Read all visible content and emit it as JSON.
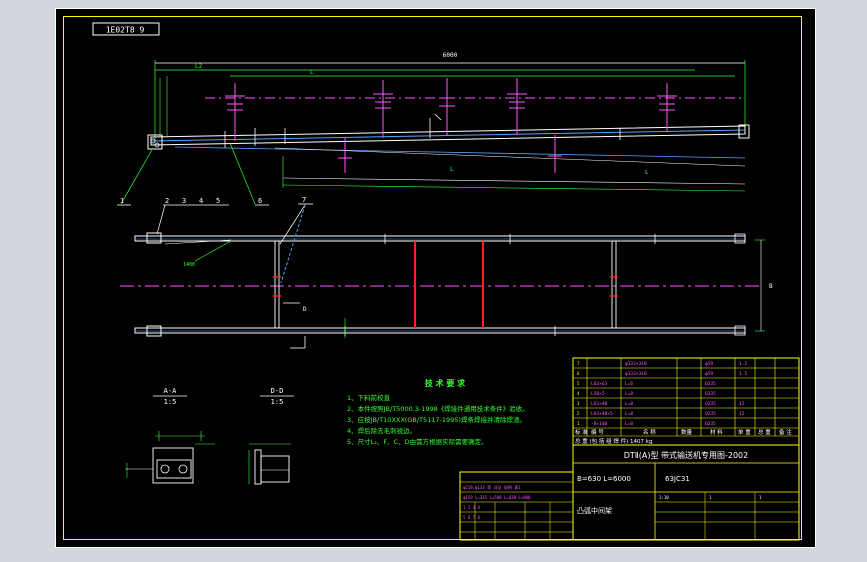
{
  "drawing": {
    "code_box": "1E02T8 9",
    "overall_dim": "6000",
    "dim_l2": "L2",
    "dim_top_mid": "L",
    "dim_bottom_mid": "L",
    "dim_bottom_right": "L",
    "dim_right": "B",
    "dim_small_left": "1400",
    "section_mark": "D",
    "part_labels": [
      "1",
      "2",
      "3",
      "4",
      "5",
      "6",
      "7"
    ],
    "section_a_title": "A-A",
    "section_a_scale": "1:5",
    "section_b_title": "D-D",
    "section_b_scale": "1:5"
  },
  "tech": {
    "title": "技 术 要 求",
    "lines": [
      "1、下料前校直",
      "2、本件按照JB/T5000.3-1998《焊接件通用技术条件》验收。",
      "3、应按JB/T10XXX(GB/T5117-1995)焊条焊接并清除焊渣。",
      "4、焊后除去毛刺锐边。",
      "5、尺寸L₂、F、C、D由需方根据实际需要确定。"
    ]
  },
  "title_block": {
    "standard_title": "DTⅡ(A)型  带式输送机专用图-2002",
    "spec": "B=630 L=6000",
    "drawing_no": "63JC31",
    "part_name": "凸弧中间架",
    "row_labels": [
      "标 准",
      "编 号",
      "名 称",
      "数量",
      "材 料",
      "单 重",
      "总 重",
      "备 注"
    ],
    "summary_row": "总  重  (包  括  组  焊  件)  1407  kg"
  }
}
